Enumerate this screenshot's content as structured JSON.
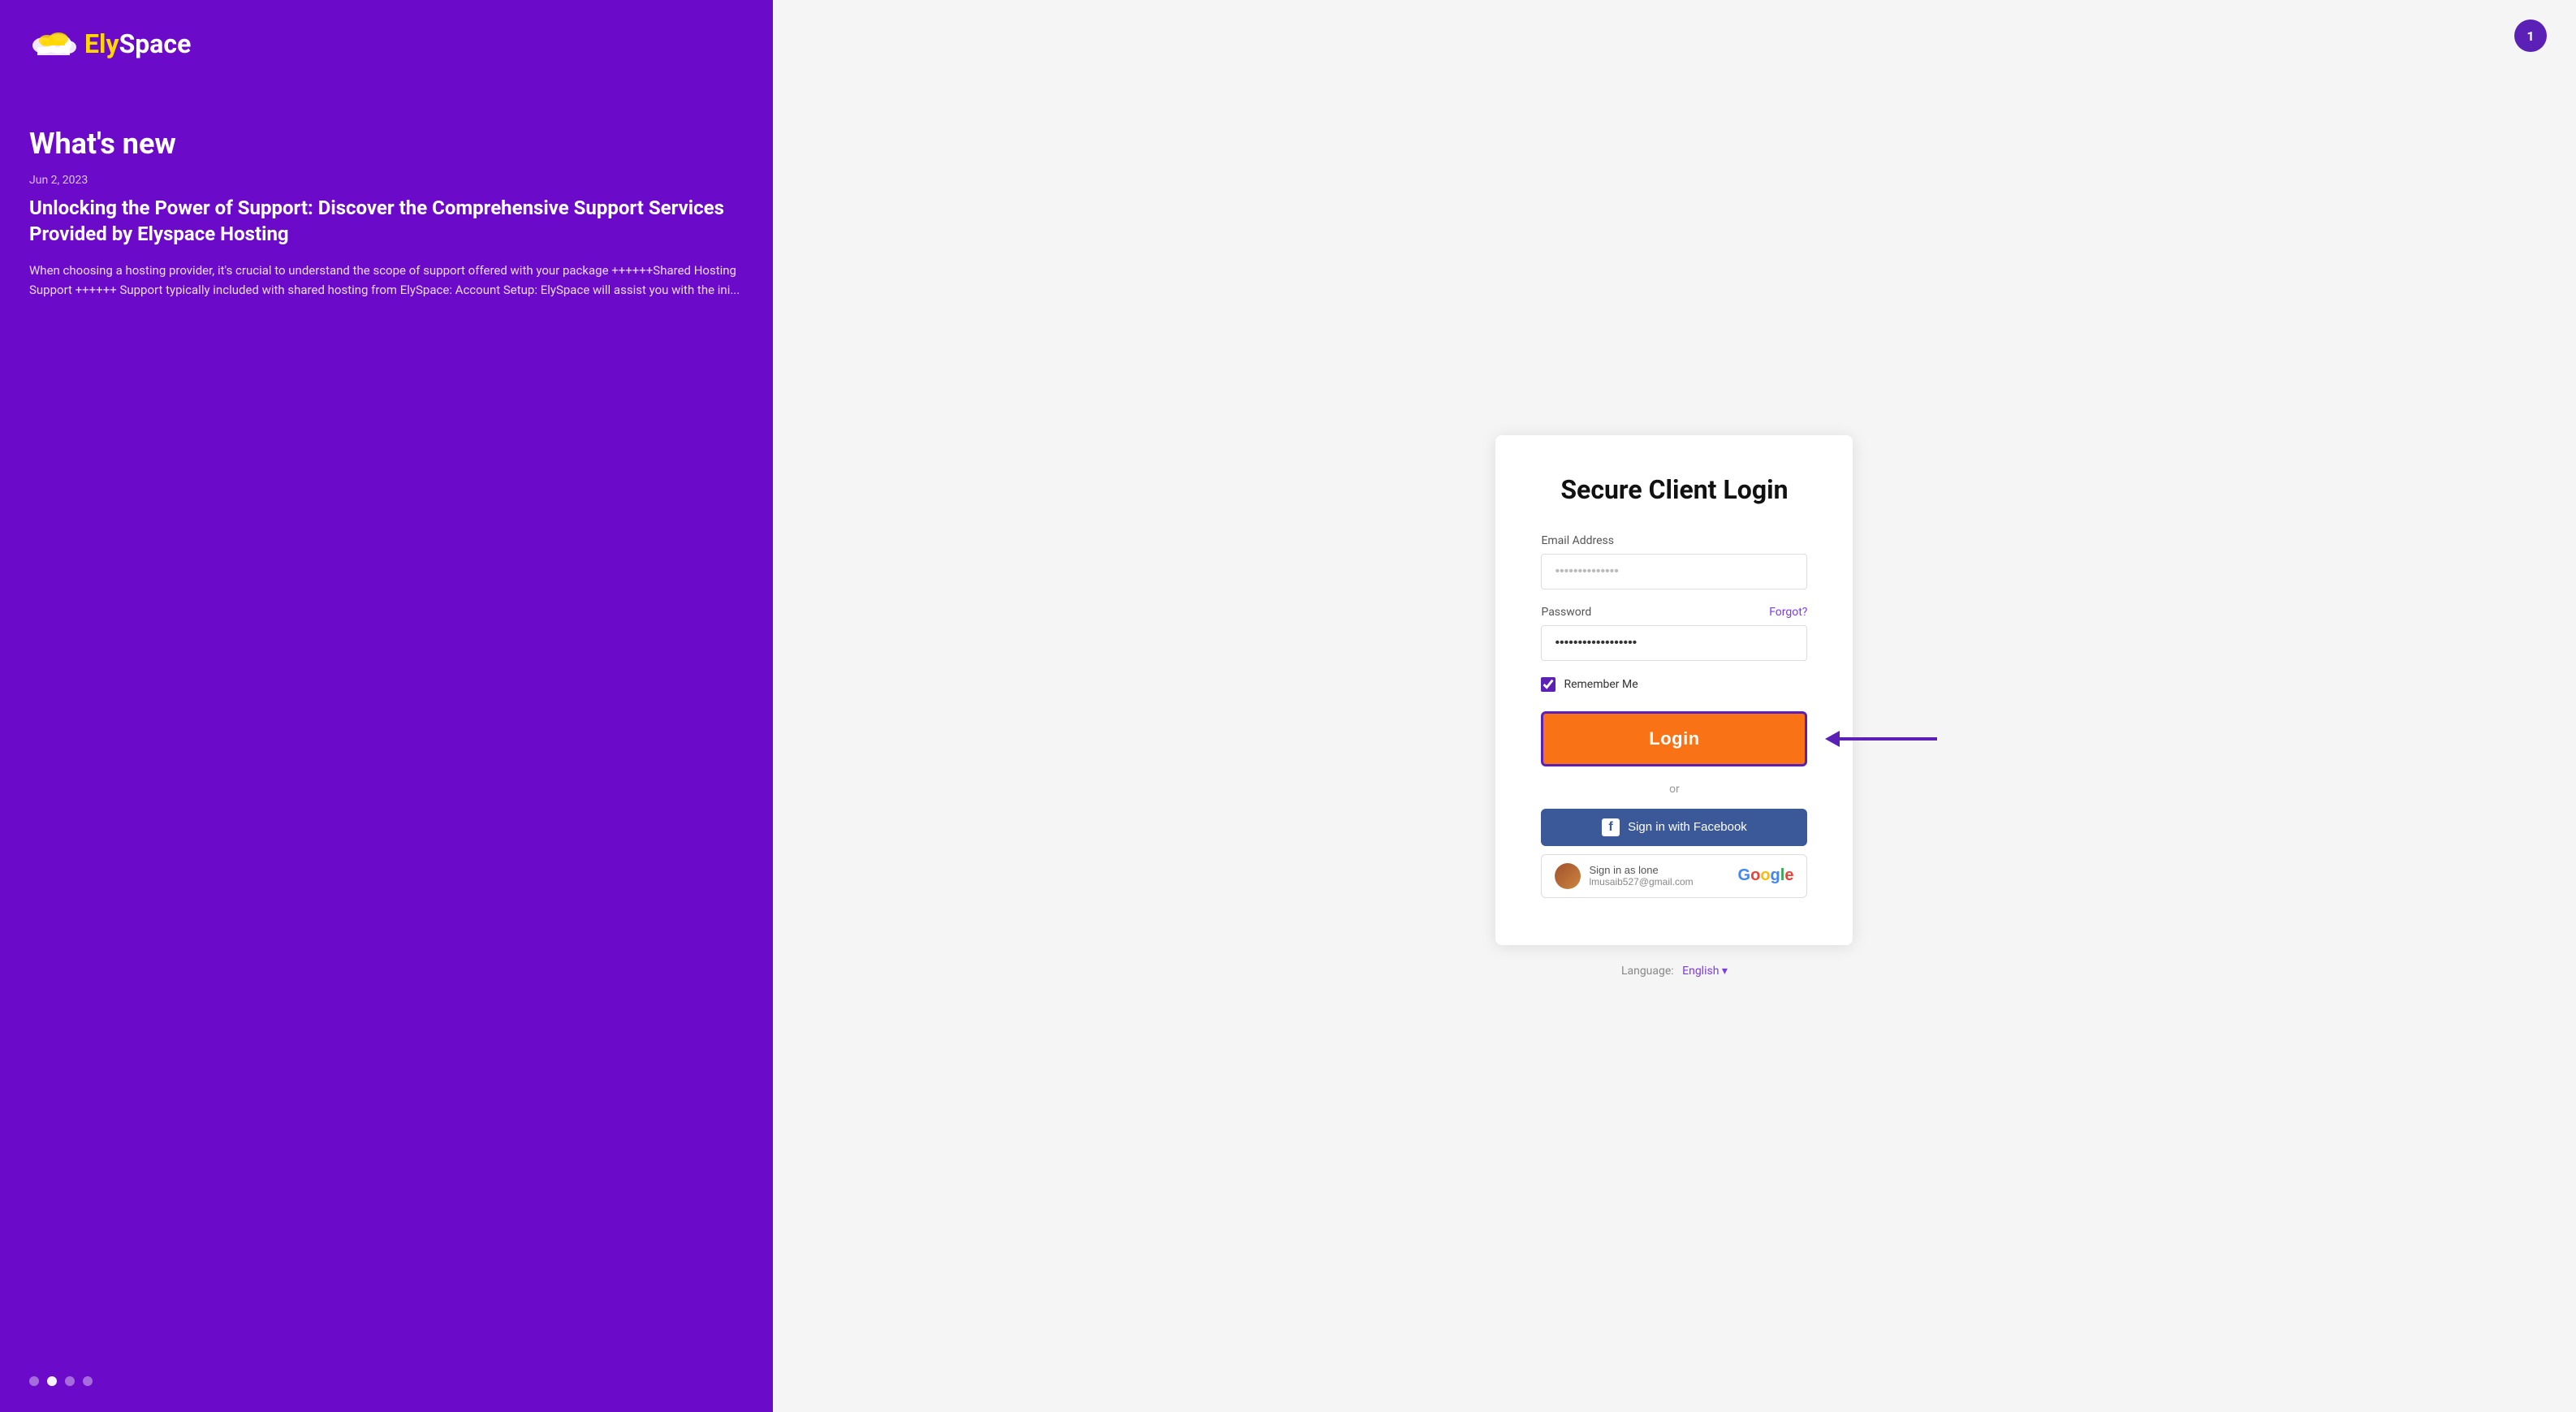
{
  "left": {
    "logo": {
      "ely": "Ely",
      "space": "Space"
    },
    "whats_new_label": "What's new",
    "article": {
      "date": "Jun 2, 2023",
      "title": "Unlocking the Power of Support: Discover the Comprehensive Support Services Provided by Elyspace Hosting",
      "excerpt": "  When choosing a hosting provider, it's crucial to understand the scope of support offered with your package    ++++++Shared Hosting Support ++++++ Support typically included with shared hosting from ElySpace: Account Setup: ElySpace will assist you with the ini..."
    },
    "dots": [
      {
        "active": false
      },
      {
        "active": true
      },
      {
        "active": false
      },
      {
        "active": false
      }
    ]
  },
  "notification": {
    "count": "1"
  },
  "login_card": {
    "title": "Secure Client Login",
    "email_label": "Email Address",
    "email_placeholder": "••••••••••••••",
    "password_label": "Password",
    "forgot_label": "Forgot?",
    "password_value": "••••••••••••••••••",
    "remember_label": "Remember Me",
    "login_button_label": "Login",
    "or_label": "or",
    "facebook_btn_label": "Sign in with Facebook",
    "google_btn_sign_in": "Sign in as lone",
    "google_btn_email": "lmusaib527@gmail.com",
    "language_label": "Language:",
    "language_value": "English"
  }
}
